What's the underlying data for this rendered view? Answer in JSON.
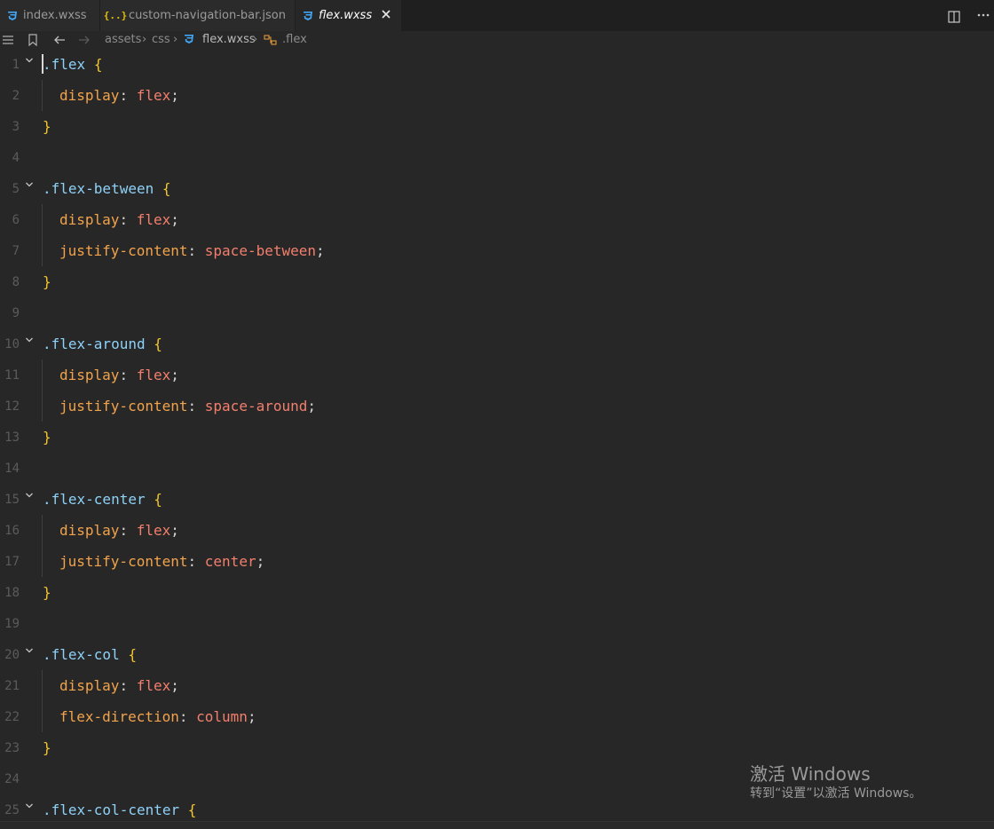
{
  "tabs": [
    {
      "label": "index.wxss",
      "icon": "css-icon",
      "active": false
    },
    {
      "label": "custom-navigation-bar.json",
      "icon": "json-icon",
      "active": false
    },
    {
      "label": "flex.wxss",
      "icon": "css-icon",
      "active": true
    }
  ],
  "json_icon_glyph": "{..}",
  "breadcrumb": [
    "assets",
    "css",
    "flex.wxss",
    ".flex"
  ],
  "editor": {
    "lines": [
      {
        "n": "1"
      },
      {
        "n": "2"
      },
      {
        "n": "3"
      },
      {
        "n": "4"
      },
      {
        "n": "5"
      },
      {
        "n": "6"
      },
      {
        "n": "7"
      },
      {
        "n": "8"
      },
      {
        "n": "9"
      },
      {
        "n": "10"
      },
      {
        "n": "11"
      },
      {
        "n": "12"
      },
      {
        "n": "13"
      },
      {
        "n": "14"
      },
      {
        "n": "15"
      },
      {
        "n": "16"
      },
      {
        "n": "17"
      },
      {
        "n": "18"
      },
      {
        "n": "19"
      },
      {
        "n": "20"
      },
      {
        "n": "21"
      },
      {
        "n": "22"
      },
      {
        "n": "23"
      },
      {
        "n": "24"
      },
      {
        "n": "25"
      }
    ],
    "code": {
      "flex": {
        "selector": ".flex",
        "display": "display",
        "display_value": "flex"
      },
      "flex_between": {
        "selector": ".flex-between",
        "display": "display",
        "display_value": "flex",
        "justify": "justify-content",
        "justify_value": "space-between"
      },
      "flex_around": {
        "selector": ".flex-around",
        "display": "display",
        "display_value": "flex",
        "justify": "justify-content",
        "justify_value": "space-around"
      },
      "flex_center": {
        "selector": ".flex-center",
        "display": "display",
        "display_value": "flex",
        "justify": "justify-content",
        "justify_value": "center"
      },
      "flex_col": {
        "selector": ".flex-col",
        "display": "display",
        "display_value": "flex",
        "direction": "flex-direction",
        "direction_value": "column"
      },
      "flex_col_center": {
        "selector": ".flex-col-center"
      }
    },
    "tokens": {
      "open_brace": "{",
      "close_brace": "}",
      "colon": ":",
      "semicolon": ";"
    }
  },
  "watermark": {
    "title": "激活 Windows",
    "subtitle": "转到“设置”以激活 Windows。"
  },
  "colors": {
    "selector": "#8ed1f7",
    "brace": "#f2c531",
    "property": "#f2a34b",
    "value": "#f37f6d",
    "css_icon": "#42a5f5",
    "json_icon": "#e6c000"
  }
}
